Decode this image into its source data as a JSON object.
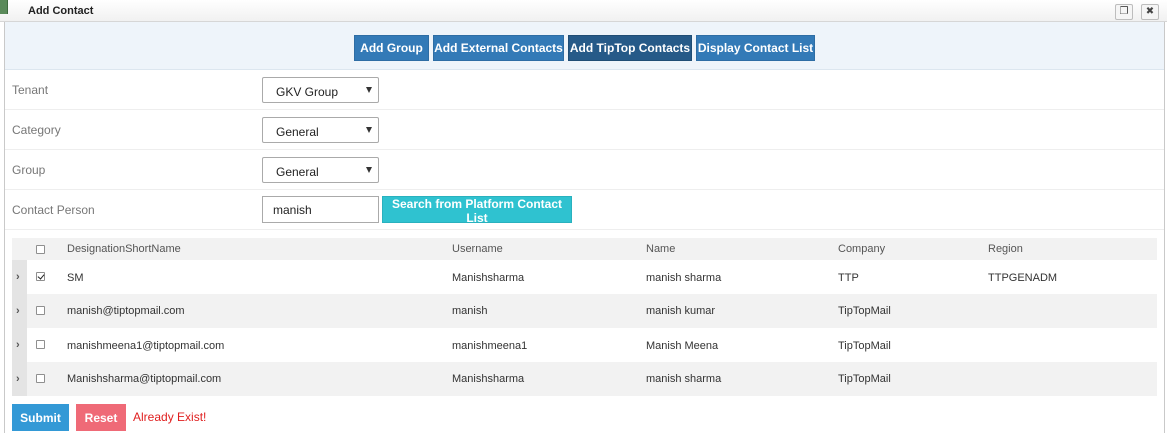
{
  "window": {
    "title": "Add Contact"
  },
  "toolbar": {
    "add_group": "Add Group",
    "add_external": "Add External Contacts",
    "add_tiptop": "Add TipTop Contacts",
    "display_list": "Display Contact List"
  },
  "form": {
    "tenant": {
      "label": "Tenant",
      "value": "GKV Group"
    },
    "category": {
      "label": "Category",
      "value": "General"
    },
    "group": {
      "label": "Group",
      "value": "General"
    },
    "contact_person": {
      "label": "Contact Person",
      "value": "manish"
    },
    "search_button": "Search from Platform Contact List"
  },
  "grid": {
    "headers": {
      "designation": "DesignationShortName",
      "username": "Username",
      "name": "Name",
      "company": "Company",
      "region": "Region"
    },
    "rows": [
      {
        "designation": "SM",
        "username": "Manishsharma",
        "name": "manish sharma",
        "company": "TTP",
        "region": "TTPGENADM",
        "checked": true
      },
      {
        "designation": "manish@tiptopmail.com",
        "username": "manish",
        "name": "manish kumar",
        "company": "TipTopMail",
        "region": "",
        "checked": false
      },
      {
        "designation": "manishmeena1@tiptopmail.com",
        "username": "manishmeena1",
        "name": "Manish Meena",
        "company": "TipTopMail",
        "region": "",
        "checked": false
      },
      {
        "designation": "Manishsharma@tiptopmail.com",
        "username": "Manishsharma",
        "name": "manish sharma",
        "company": "TipTopMail",
        "region": "",
        "checked": false
      }
    ]
  },
  "footer": {
    "submit": "Submit",
    "reset": "Reset",
    "message": "Already Exist!"
  },
  "colors": {
    "primary": "#337ab7",
    "primary_active": "#265a88",
    "search": "#2fc2d0",
    "submit": "#3399d6",
    "reset": "#ef6a77",
    "error": "#e02020"
  }
}
